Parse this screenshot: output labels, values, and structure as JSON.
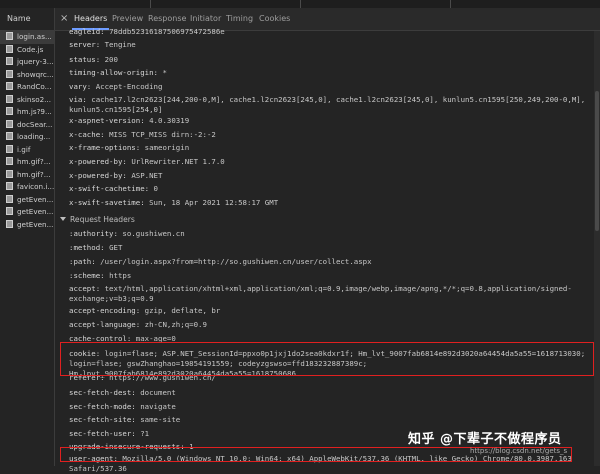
{
  "left_panel": {
    "header": "Name",
    "files": [
      "login.as...",
      "Code.js",
      "jquery-3...",
      "showqrc...",
      "RandCo...",
      "skinso2...",
      "hm.js?9...",
      "docSear...",
      "loading...",
      "i.gif",
      "hm.gif?...",
      "hm.gif?...",
      "favicon.i...",
      "getEven...",
      "getEven...",
      "getEven..."
    ]
  },
  "tabs": {
    "close": "×",
    "items": [
      "Headers",
      "Preview",
      "Response",
      "Initiator",
      "Timing",
      "Cookies"
    ]
  },
  "response_headers": [
    {
      "k": "eagleid:",
      "v": "78ddb5231618750697547258​6e"
    },
    {
      "k": "server:",
      "v": "Tengine"
    },
    {
      "k": "status:",
      "v": "200"
    },
    {
      "k": "timing-allow-origin:",
      "v": "*"
    },
    {
      "k": "vary:",
      "v": "Accept-Encoding"
    },
    {
      "k": "via:",
      "v": "cache17.l2cn2623[244,200-0,M], cache1.l2cn2623[245,0], cache1.l2cn2623[245,0], kunlun5.cn1595[250,249,200-0,M], kunlun5.cn1595[254,0]"
    },
    {
      "k": "x-aspnet-version:",
      "v": "4.0.30319"
    },
    {
      "k": "x-cache:",
      "v": "MISS TCP_MISS dirn:-2:-2"
    },
    {
      "k": "x-frame-options:",
      "v": "sameorigin"
    },
    {
      "k": "x-powered-by:",
      "v": "UrlRewriter.NET 1.7.0"
    },
    {
      "k": "x-powered-by:",
      "v": "ASP.NET"
    },
    {
      "k": "x-swift-cachetime:",
      "v": "0"
    },
    {
      "k": "x-swift-savetime:",
      "v": "Sun, 18 Apr 2021 12:58:17 GMT"
    }
  ],
  "request_section": "Request Headers",
  "request_headers": [
    {
      "k": ":authority:",
      "v": "so.gushiwen.cn"
    },
    {
      "k": ":method:",
      "v": "GET"
    },
    {
      "k": ":path:",
      "v": "/user/login.aspx?from=http://so.gushiwen.cn/user/collect.aspx"
    },
    {
      "k": ":scheme:",
      "v": "https"
    },
    {
      "k": "accept:",
      "v": "text/html,application/xhtml+xml,application/xml;q=0.9,image/webp,image/apng,*/*;q=0.8,application/signed-exchange;v=b3;q=0.9"
    },
    {
      "k": "accept-encoding:",
      "v": "gzip, deflate, br"
    },
    {
      "k": "accept-language:",
      "v": "zh-CN,zh;q=0.9"
    },
    {
      "k": "cache-control:",
      "v": "max-age=0"
    },
    {
      "k": "cookie:",
      "v": "login=flase; ASP.NET_SessionId=ppxo0p1jxj1do2sea0kdxr1f; Hm_lvt_9007fab6814e892d3020a64454da5a55=1618713030; login=flase; gswZhanghao=19854191559; codeyzgswso=ffd183232887389c; Hm_lpvt_9007fab6814e892d3020a64454da5a55=1618750686"
    },
    {
      "k": "referer:",
      "v": "https://www.gushiwen.cn/"
    },
    {
      "k": "sec-fetch-dest:",
      "v": "document"
    },
    {
      "k": "sec-fetch-mode:",
      "v": "navigate"
    },
    {
      "k": "sec-fetch-site:",
      "v": "same-site"
    },
    {
      "k": "sec-fetch-user:",
      "v": "?1"
    },
    {
      "k": "upgrade-insecure-requests:",
      "v": "1"
    },
    {
      "k": "user-agent:",
      "v": "Mozilla/5.0 (Windows NT 10.0; Win64; x64) AppleWebKit/537.36 (KHTML, like Gecko) Chrome/80.0.3987.163 Safari/537.36"
    }
  ],
  "watermark": {
    "main": "知乎 @下辈子不做程序员",
    "sub": "https://blog.csdn.net/gets_s"
  },
  "colors": {
    "highlight": "#e02020",
    "tab_accent": "#6e9cff",
    "bg": "#242424"
  }
}
